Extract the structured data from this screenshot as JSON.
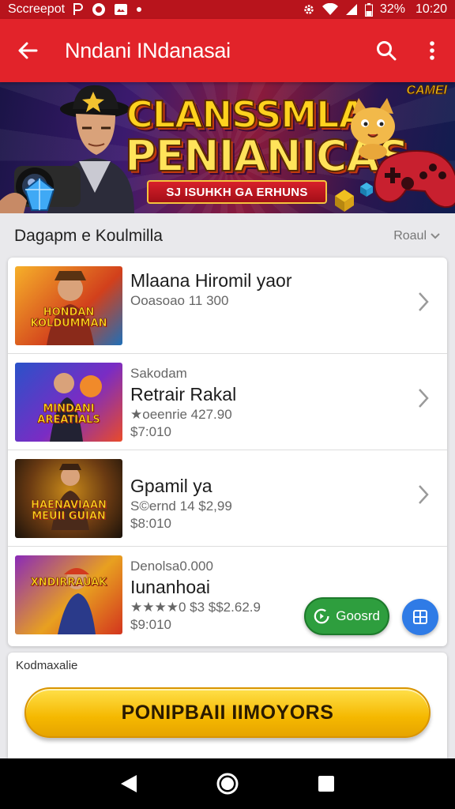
{
  "status_bar": {
    "carrier": "Sccreepot",
    "battery": "32%",
    "time": "10:20",
    "icons": [
      "p-icon",
      "record-icon",
      "photo-icon",
      "dot-icon",
      "gear-icon",
      "wifi-icon",
      "signal-icon",
      "battery-icon"
    ]
  },
  "app_bar": {
    "title": "Nndani INdanasai",
    "background": "#e2232a"
  },
  "banner": {
    "title_line1": "CLANSSMLA",
    "title_line2": "PENIANICAS",
    "ribbon": "SJ ISUHKH GA ERHUNS",
    "badge": "CAMEl"
  },
  "section": {
    "title": "Dagapm e Koulmilla",
    "sort_label": "Roaul"
  },
  "list": [
    {
      "thumb_text": "HONDAN KOLDUMMAN",
      "thumb_colors": [
        "#f0a020",
        "#c2381a",
        "#1d6fb8"
      ],
      "sub": "",
      "title": "Mlaana Hiromil yaor",
      "meta": [
        "Ooasoao 11 300"
      ]
    },
    {
      "thumb_text": "MINDANI AREATIALS",
      "thumb_colors": [
        "#2a52c9",
        "#7a2cc4",
        "#e94b2a"
      ],
      "sub": "Sakodam",
      "title": "Retrair Rakal",
      "meta": [
        "★oeenrie 427.90",
        "$7:010"
      ]
    },
    {
      "thumb_text": "HAENAVIAAN MEUII GUIAN",
      "thumb_colors": [
        "#3a2a1a",
        "#c98a1a",
        "#8a2a1a"
      ],
      "sub": "",
      "title": "Gpamil ya",
      "meta": [
        "S©ernd 14 $2,99",
        "$8:010"
      ]
    },
    {
      "thumb_text": "XNDIRRAUAK",
      "thumb_colors": [
        "#8a2ab8",
        "#e8a020",
        "#d3351e"
      ],
      "sub": "Denolsa0.000",
      "title": "Iunanhoai",
      "meta": [
        "★★★★0 $3 $$2.62.9",
        "$9:010"
      ]
    }
  ],
  "fab": {
    "label": "Goosrd",
    "green": "#2e9e3e",
    "blue": "#2f7be6"
  },
  "bottom": {
    "label": "Kodmaxalie",
    "button": "PONIPBAII IIMOYORS"
  }
}
